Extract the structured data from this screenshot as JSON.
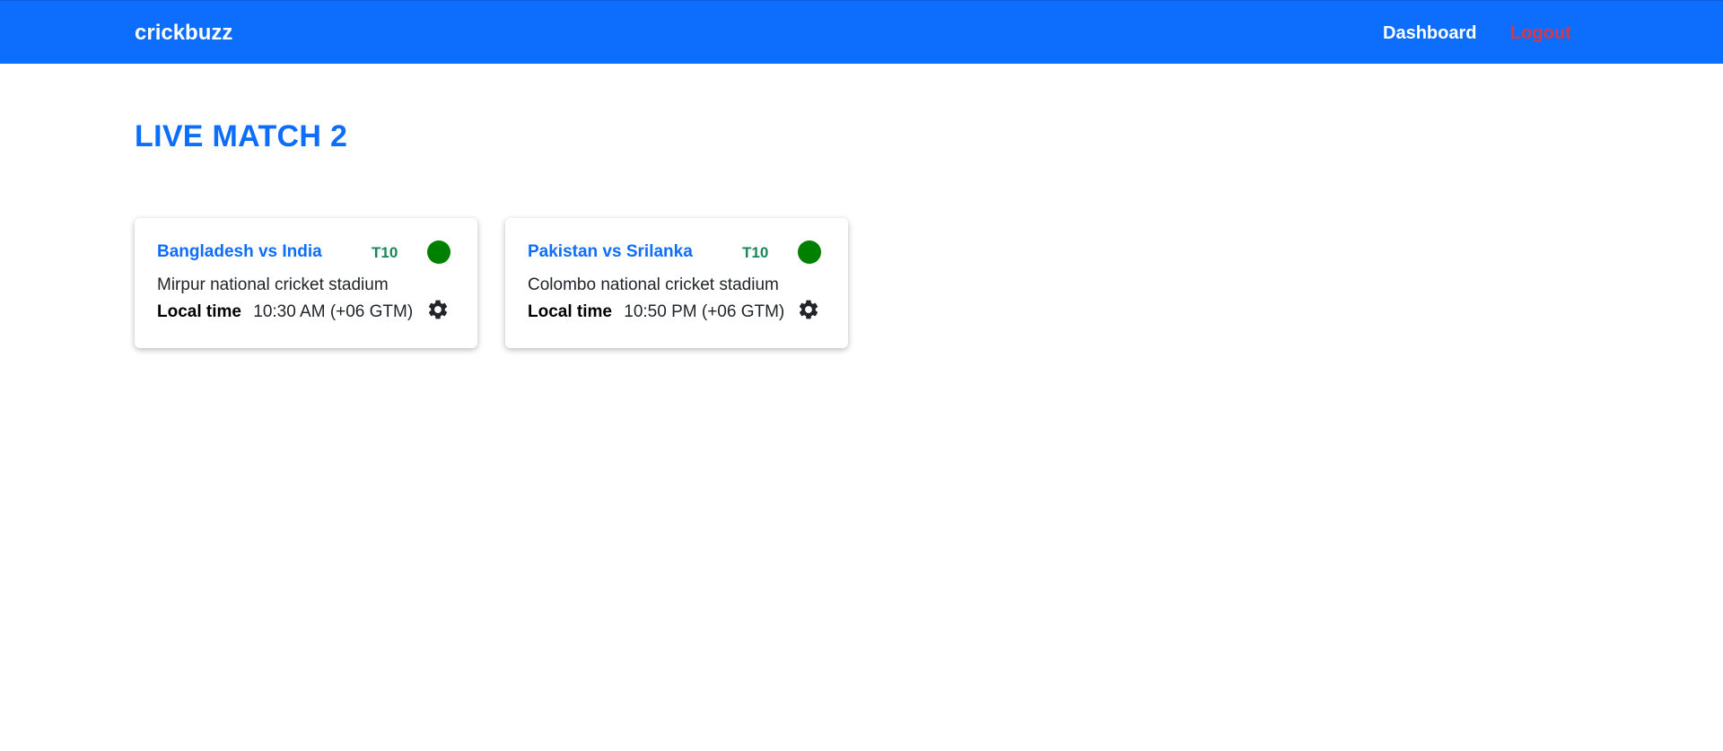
{
  "navbar": {
    "brand": "crickbuzz",
    "links": {
      "dashboard": "Dashboard",
      "logout": "Logout"
    },
    "colors": {
      "background": "#0d6efd",
      "logout": "#dc3545"
    }
  },
  "page": {
    "title": "LIVE MATCH 2"
  },
  "matches": [
    {
      "title": "Bangladesh vs India",
      "format": "T10",
      "venue": "Mirpur national cricket stadium",
      "time_label": "Local time",
      "time_value": "10:30 AM (+06 GTM)",
      "status_color": "#008000",
      "settings_icon": "gear-icon"
    },
    {
      "title": "Pakistan vs Srilanka",
      "format": "T10",
      "venue": "Colombo national cricket stadium",
      "time_label": "Local time",
      "time_value": "10:50 PM (+06 GTM)",
      "status_color": "#008000",
      "settings_icon": "gear-icon"
    }
  ]
}
